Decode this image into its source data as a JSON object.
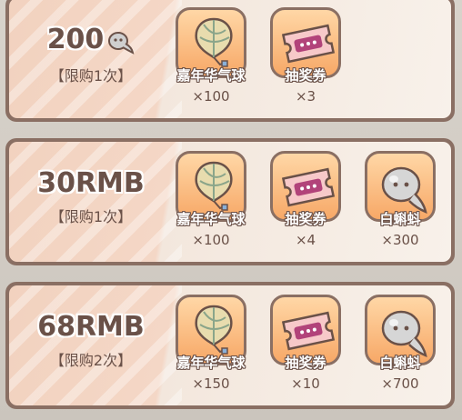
{
  "packs": [
    {
      "price": "200",
      "limit": "【限购1次】",
      "show_currency_icon": true,
      "items": [
        {
          "icon": "balloon-icon",
          "name": "嘉年华气球",
          "qty": "×100"
        },
        {
          "icon": "ticket-icon",
          "name": "抽奖券",
          "qty": "×3"
        }
      ]
    },
    {
      "price": "30RMB",
      "limit": "【限购1次】",
      "show_currency_icon": false,
      "items": [
        {
          "icon": "balloon-icon",
          "name": "嘉年华气球",
          "qty": "×100"
        },
        {
          "icon": "ticket-icon",
          "name": "抽奖券",
          "qty": "×4"
        },
        {
          "icon": "tadpole-icon",
          "name": "白蝌蚪",
          "qty": "×300"
        }
      ]
    },
    {
      "price": "68RMB",
      "limit": "【限购2次】",
      "show_currency_icon": false,
      "items": [
        {
          "icon": "balloon-icon",
          "name": "嘉年华气球",
          "qty": "×150"
        },
        {
          "icon": "ticket-icon",
          "name": "抽奖券",
          "qty": "×10"
        },
        {
          "icon": "tadpole-icon",
          "name": "白蝌蚪",
          "qty": "×700"
        }
      ]
    }
  ]
}
